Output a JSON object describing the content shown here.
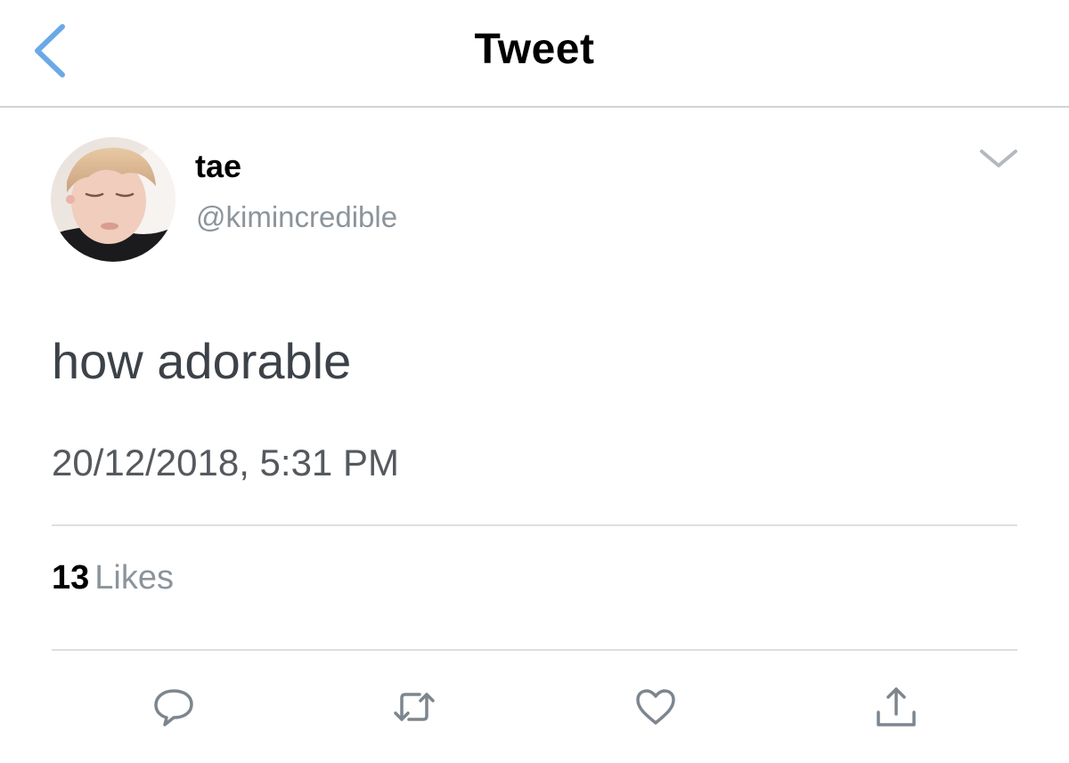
{
  "header": {
    "title": "Tweet",
    "back_icon": "back-chevron-icon"
  },
  "tweet": {
    "display_name": "tae",
    "handle": "@kimincredible",
    "text": "how adorable",
    "timestamp": "20/12/2018, 5:31 PM",
    "likes_count": "13",
    "likes_label": "Likes"
  },
  "actions": [
    "reply-icon",
    "retweet-icon",
    "like-icon",
    "share-icon"
  ],
  "colors": {
    "accent": "#6aa8e8",
    "secondary_text": "#8c949b",
    "divider": "#dcdfe2",
    "icon": "#7d868e"
  }
}
